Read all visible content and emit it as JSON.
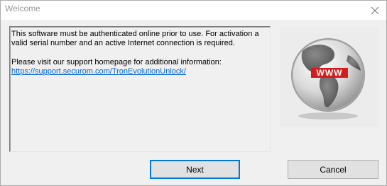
{
  "window": {
    "title": "Welcome",
    "close_icon": "close-icon"
  },
  "message": {
    "line1": "This software must be authenticated online prior to use. For activation a valid serial number and an active Internet connection is required.",
    "line2": "Please visit our support homepage for additional information:",
    "link": "https://support.securom.com/TronEvolutionUnlock/"
  },
  "logo": {
    "text": "WWW",
    "icon": "globe-icon"
  },
  "buttons": {
    "next": "Next",
    "cancel": "Cancel"
  },
  "colors": {
    "link": "#0066cc",
    "logo_banner": "#d31c1c",
    "default_button_border": "#0078d7"
  }
}
